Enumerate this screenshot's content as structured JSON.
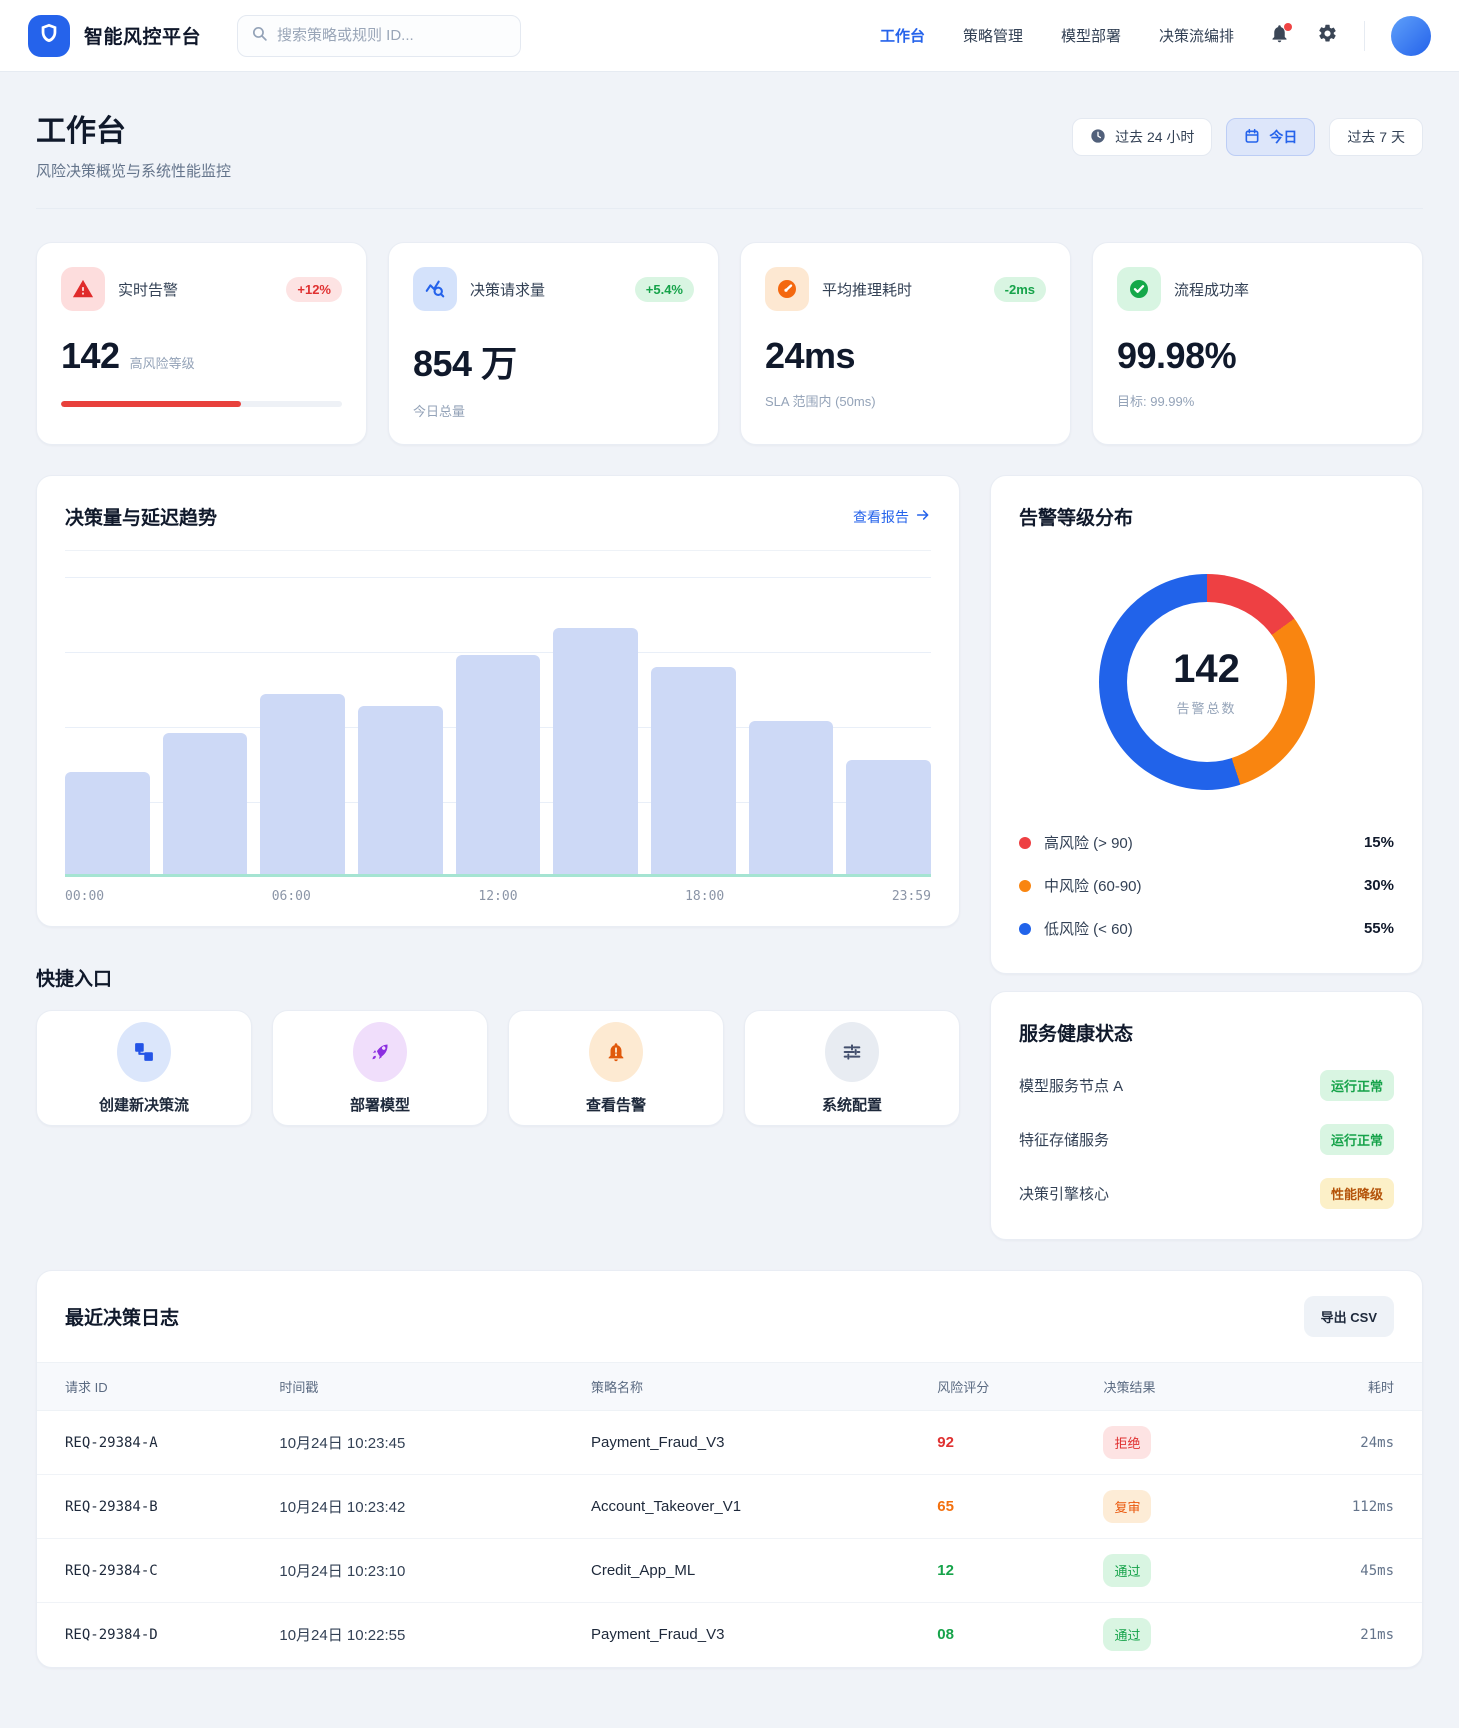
{
  "header": {
    "brand": "智能风控平台",
    "search_placeholder": "搜索策略或规则 ID...",
    "nav": [
      {
        "label": "工作台"
      },
      {
        "label": "策略管理"
      },
      {
        "label": "模型部署"
      },
      {
        "label": "决策流编排"
      }
    ]
  },
  "page_head": {
    "title": "工作台",
    "subtitle": "风险决策概览与系统性能监控",
    "filters": [
      {
        "label": "过去 24 小时"
      },
      {
        "label": "今日"
      },
      {
        "label": "过去 7 天"
      }
    ]
  },
  "kpis": [
    {
      "title": "实时告警",
      "badge": "+12%",
      "value": "142",
      "caption": "高风险等级",
      "progress_pct": 64
    },
    {
      "title": "决策请求量",
      "badge": "+5.4%",
      "value": "854 万",
      "caption": "今日总量"
    },
    {
      "title": "平均推理耗时",
      "badge": "-2ms",
      "value": "24ms",
      "caption": "SLA 范围内 (50ms)"
    },
    {
      "title": "流程成功率",
      "value": "99.98%",
      "caption": "目标: 99.99%"
    }
  ],
  "trend_card": {
    "title": "决策量与延迟趋势",
    "link_label": "查看报告",
    "chart_data": {
      "type": "bar",
      "x_ticks": [
        "00:00",
        "06:00",
        "12:00",
        "18:00",
        "23:59"
      ],
      "values": [
        35,
        48,
        61,
        57,
        74,
        83,
        70,
        52,
        39
      ],
      "ylim": [
        0,
        100
      ],
      "grid": true,
      "bar_color": "#cdd9f6",
      "baseline_color": "#a5e4d2"
    }
  },
  "alert_card": {
    "title": "告警等级分布",
    "total": "142",
    "total_label": "告警总数",
    "chart_data": {
      "type": "pie",
      "segments": [
        {
          "label": "高风险 (> 90)",
          "pct": 15,
          "pct_label": "15%",
          "color": "#ee4043"
        },
        {
          "label": "中风险 (60-90)",
          "pct": 30,
          "pct_label": "30%",
          "color": "#f98510"
        },
        {
          "label": "低风险 (< 60)",
          "pct": 55,
          "pct_label": "55%",
          "color": "#2163ea"
        }
      ]
    }
  },
  "quick_section": {
    "title": "快捷入口",
    "items": [
      {
        "label": "创建新决策流"
      },
      {
        "label": "部署模型"
      },
      {
        "label": "查看告警"
      },
      {
        "label": "系统配置"
      }
    ]
  },
  "health_card": {
    "title": "服务健康状态",
    "items": [
      {
        "name": "模型服务节点 A",
        "status": "运行正常",
        "level": "ok"
      },
      {
        "name": "特征存储服务",
        "status": "运行正常",
        "level": "ok"
      },
      {
        "name": "决策引擎核心",
        "status": "性能降级",
        "level": "degraded"
      }
    ]
  },
  "logs_card": {
    "title": "最近决策日志",
    "export_label": "导出 CSV",
    "columns": [
      "请求 ID",
      "时间戳",
      "策略名称",
      "风险评分",
      "决策结果",
      "耗时"
    ],
    "rows": [
      {
        "id": "REQ-29384-A",
        "time": "10月24日 10:23:45",
        "policy": "Payment_Fraud_V3",
        "score": "92",
        "score_level": "high",
        "result": "拒绝",
        "result_level": "reject",
        "latency": "24ms"
      },
      {
        "id": "REQ-29384-B",
        "time": "10月24日 10:23:42",
        "policy": "Account_Takeover_V1",
        "score": "65",
        "score_level": "mid",
        "result": "复审",
        "result_level": "review",
        "latency": "112ms"
      },
      {
        "id": "REQ-29384-C",
        "time": "10月24日 10:23:10",
        "policy": "Credit_App_ML",
        "score": "12",
        "score_level": "low",
        "result": "通过",
        "result_level": "pass",
        "latency": "45ms"
      },
      {
        "id": "REQ-29384-D",
        "time": "10月24日 10:22:55",
        "policy": "Payment_Fraud_V3",
        "score": "08",
        "score_level": "low",
        "result": "通过",
        "result_level": "pass",
        "latency": "21ms"
      }
    ]
  }
}
